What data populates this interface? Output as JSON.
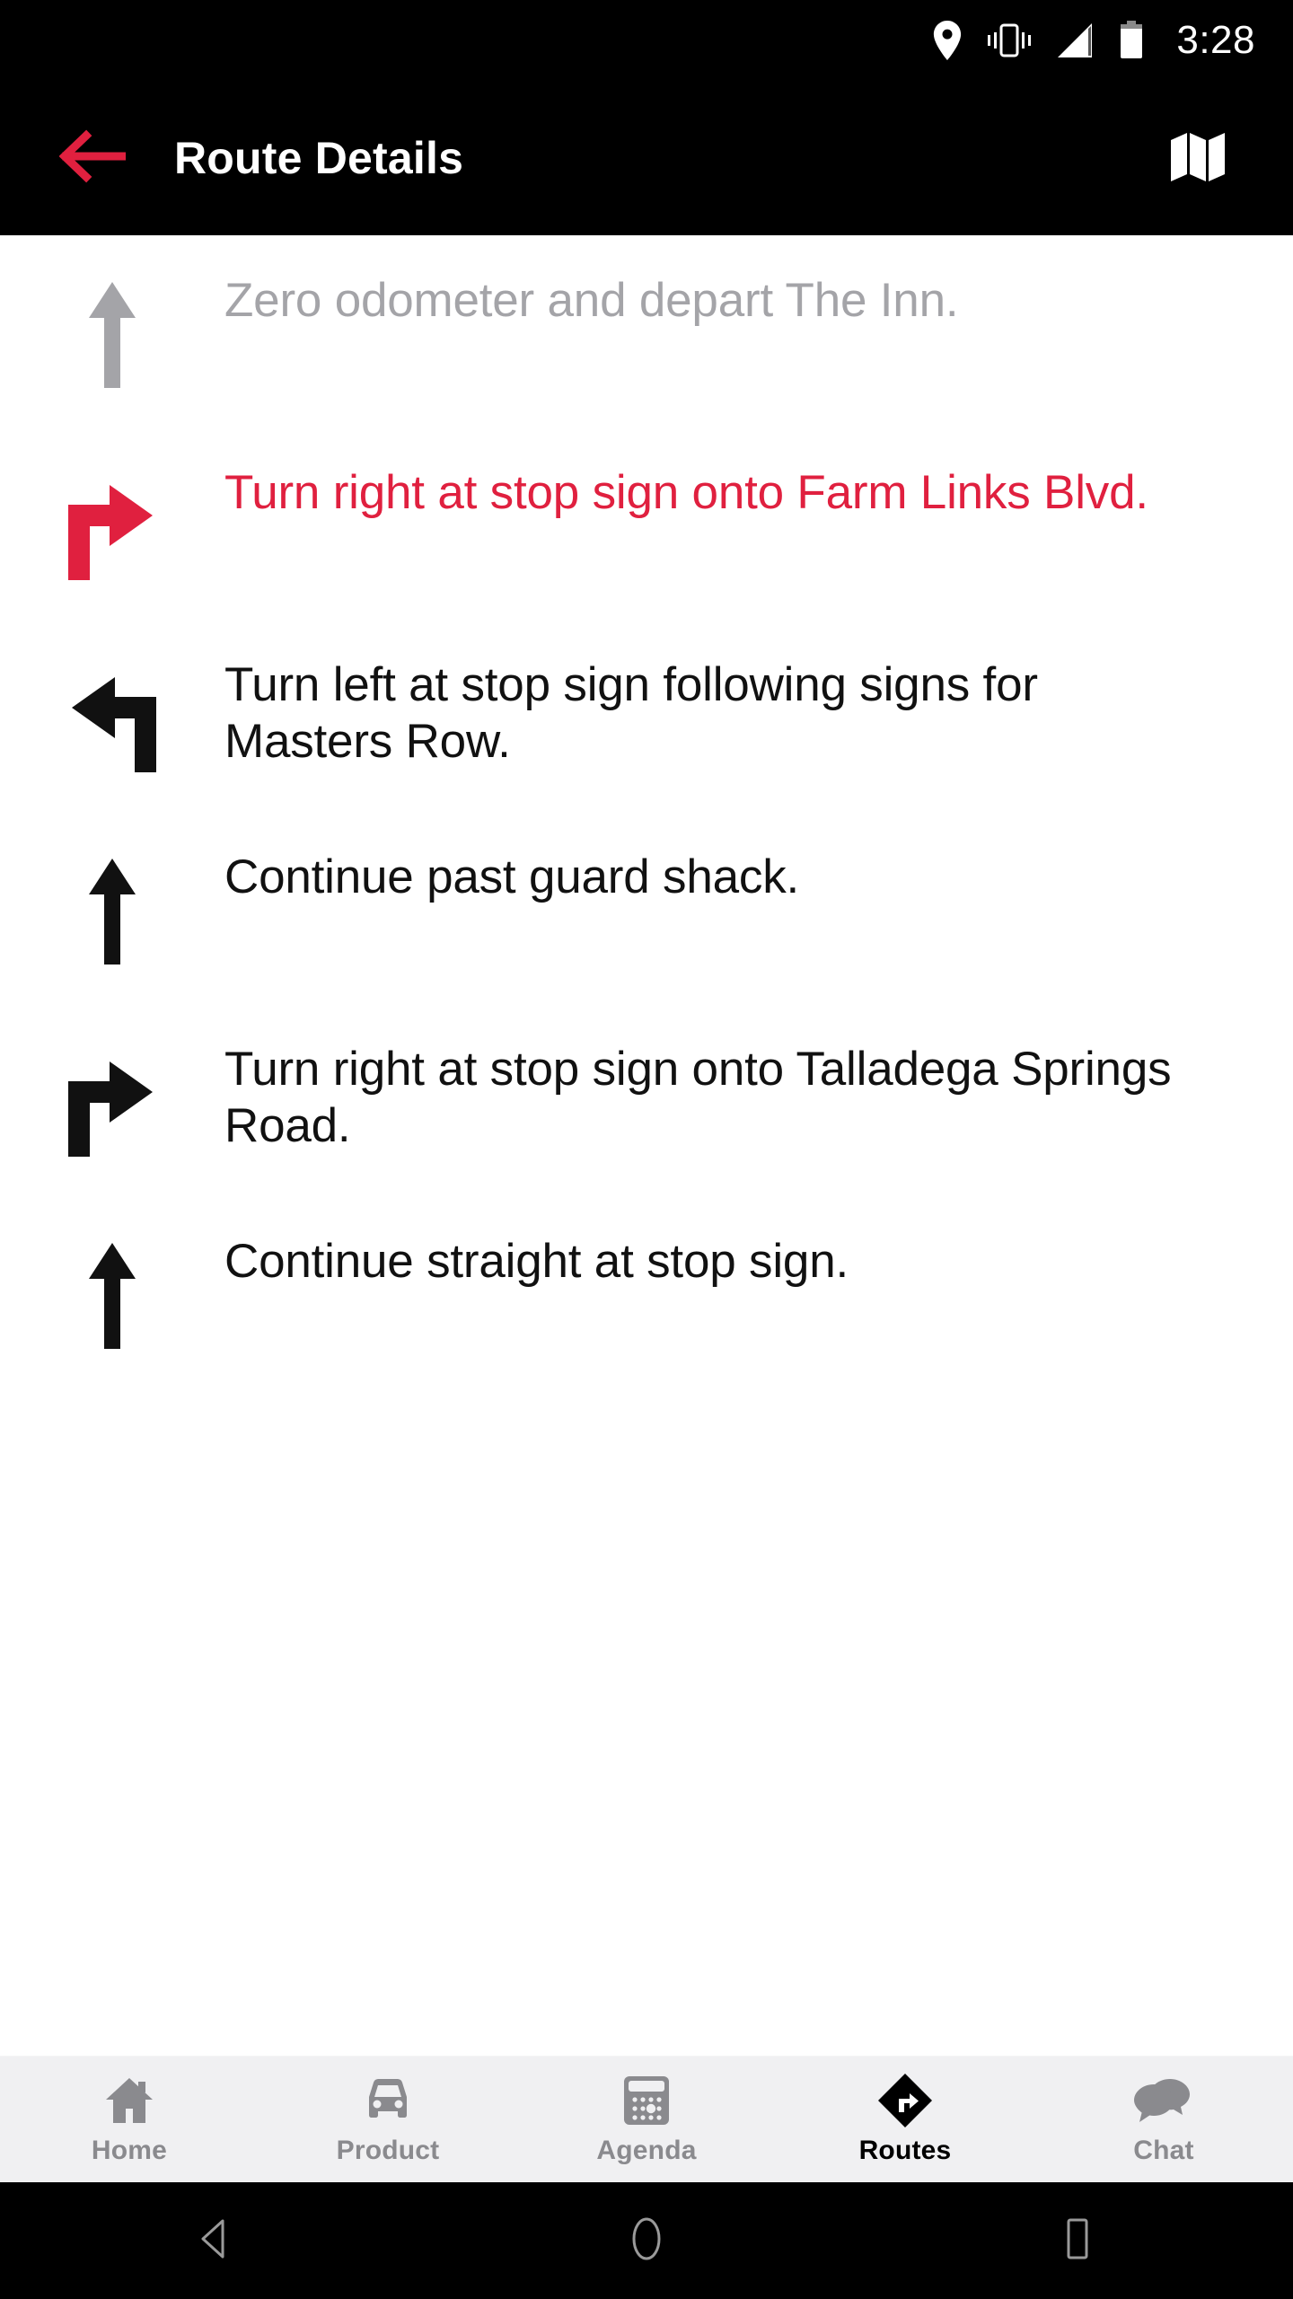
{
  "status_bar": {
    "time": "3:28",
    "icons": [
      "location-pin-icon",
      "vibrate-icon",
      "signal-bars-icon",
      "battery-icon"
    ]
  },
  "app_bar": {
    "title": "Route Details",
    "back_icon": "back-arrow-icon",
    "map_icon": "map-icon",
    "accent_color": "#e0203f",
    "background_color": "#000000"
  },
  "route_steps": [
    {
      "icon": "arrow-straight-icon",
      "text": "Zero odometer and depart The Inn.",
      "state": "completed",
      "color": "#a4a4a8"
    },
    {
      "icon": "arrow-turn-right-icon",
      "text": "Turn right at stop sign onto Farm Links Blvd.",
      "state": "current",
      "color": "#e0203f"
    },
    {
      "icon": "arrow-turn-left-icon",
      "text": "Turn left at stop sign following signs for Masters Row.",
      "state": "upcoming",
      "color": "#111111"
    },
    {
      "icon": "arrow-straight-icon",
      "text": "Continue past guard shack.",
      "state": "upcoming",
      "color": "#111111"
    },
    {
      "icon": "arrow-turn-right-icon",
      "text": "Turn right at stop sign onto Talladega Springs Road.",
      "state": "upcoming",
      "color": "#111111"
    },
    {
      "icon": "arrow-straight-icon",
      "text": "Continue straight at stop sign.",
      "state": "upcoming",
      "color": "#111111"
    }
  ],
  "bottom_nav": {
    "items": [
      {
        "label": "Home",
        "icon": "home-icon",
        "active": false
      },
      {
        "label": "Product",
        "icon": "car-icon",
        "active": false
      },
      {
        "label": "Agenda",
        "icon": "calendar-icon",
        "active": false
      },
      {
        "label": "Routes",
        "icon": "directions-icon",
        "active": true
      },
      {
        "label": "Chat",
        "icon": "chat-bubbles-icon",
        "active": false
      }
    ],
    "active_color": "#000000",
    "inactive_color": "#8a8a8e",
    "background_color": "#f0f0f2"
  },
  "android_nav": {
    "back": "android-back-icon",
    "home": "android-home-icon",
    "recents": "android-recents-icon"
  }
}
